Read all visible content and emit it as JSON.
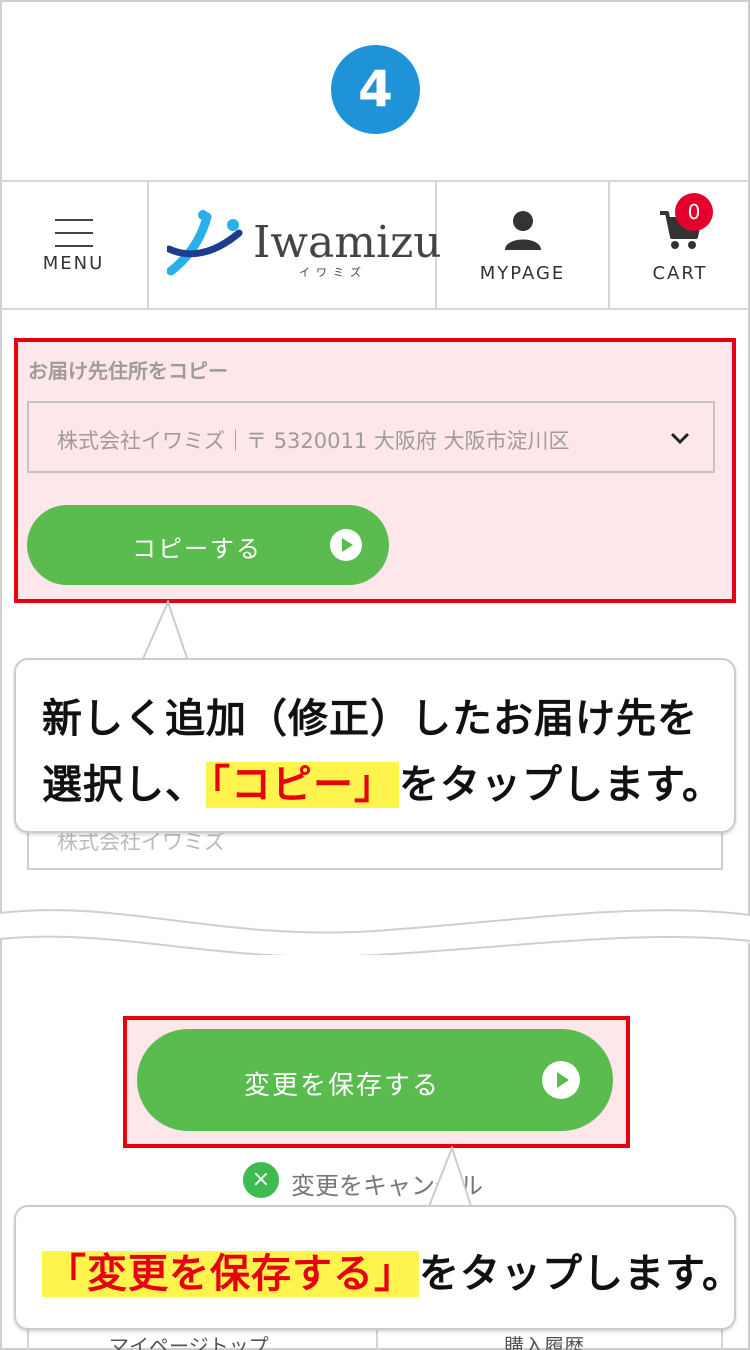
{
  "step": {
    "number": "4"
  },
  "header": {
    "menu_label": "MENU",
    "logo_text": "Iwamizu",
    "logo_kana": "イワミズ",
    "mypage_label": "MYPAGE",
    "cart_label": "CART",
    "cart_count": "0"
  },
  "copy_section": {
    "title": "お届け先住所をコピー",
    "selected_address": "株式会社イワミズ｜〒 5320011 大阪府 大阪市淀川区",
    "copy_button": "コピーする"
  },
  "callout1": {
    "line1": "新しく追加（修正）したお届け先を",
    "line2_prefix": "選択し、",
    "line2_highlight": "「コピー」",
    "line2_suffix": "をタップします。"
  },
  "company_input": {
    "value": "株式会社イワミズ"
  },
  "save_section": {
    "save_button": "変更を保存する",
    "cancel_label": "変更をキャンセル"
  },
  "callout2": {
    "highlight": "「変更を保存する」",
    "suffix": "をタップします。"
  },
  "bottom_nav": {
    "left": "マイページトップ",
    "right": "購入履歴"
  },
  "colors": {
    "accent_green": "#5abc4f",
    "highlight_red": "#e60012",
    "step_blue": "#1f93d8",
    "marker_yellow": "#fff34d"
  }
}
